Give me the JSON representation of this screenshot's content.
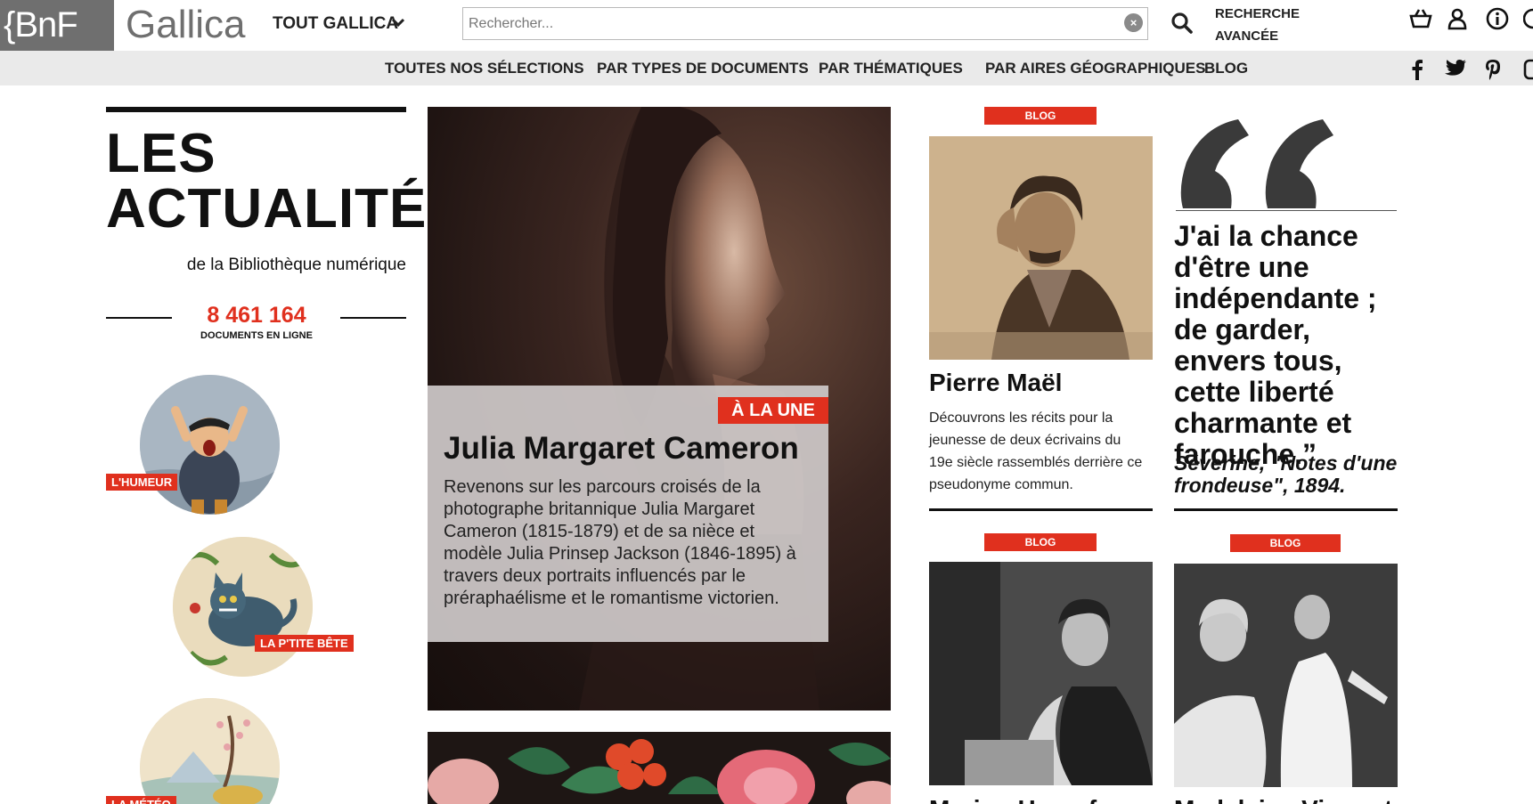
{
  "header": {
    "bnf_logo": "{BnF",
    "gallica_logo": "Gallica",
    "scope_label": "TOUT GALLICA",
    "search_placeholder": "Rechercher...",
    "clear_glyph": "×",
    "advanced_search": "RECHERCHE AVANCÉE"
  },
  "nav": {
    "items": [
      "TOUTES NOS SÉLECTIONS",
      "PAR TYPES DE DOCUMENTS",
      "PAR THÉMATIQUES",
      "PAR AIRES GÉOGRAPHIQUES",
      "BLOG"
    ]
  },
  "news": {
    "title": "LES ACTUALITÉS",
    "subtitle": "de la Bibliothèque numérique",
    "doc_count": "8 461 164",
    "doc_count_label": "DOCUMENTS EN LIGNE",
    "circles": [
      {
        "label": "L'HUMEUR"
      },
      {
        "label": "LA P'TITE BÊTE"
      },
      {
        "label": "LA MÉTÉO"
      }
    ]
  },
  "feature": {
    "badge": "À LA UNE",
    "title": "Julia Margaret Cameron",
    "description": "Revenons sur les parcours croisés de la photographe britannique Julia Margaret Cameron (1815-1879) et de sa nièce et modèle Julia Prinsep Jackson (1846-1895) à travers deux portraits influencés par le préraphaélisme et le romantisme victorien."
  },
  "cards": {
    "blog_label": "BLOG",
    "card1": {
      "title": "Pierre Maël",
      "description": "Découvrons les récits pour la jeunesse de deux écrivains du 19e siècle rassemblés derrière ce pseudonyme commun."
    },
    "quote": {
      "text": "J'ai la chance d'être une indépendante ; de garder, envers tous, cette liberté charmante et farouche.”",
      "source": "Séverine, \"Notes d'une frondeuse\", 1894."
    },
    "card3": {
      "title": "Marion Heranf"
    },
    "card4": {
      "title": "Madeleine Vionnet"
    }
  },
  "colors": {
    "accent": "#e0301e",
    "logo_grey": "#6f6f6f",
    "nav_bg": "#eaeaea"
  }
}
